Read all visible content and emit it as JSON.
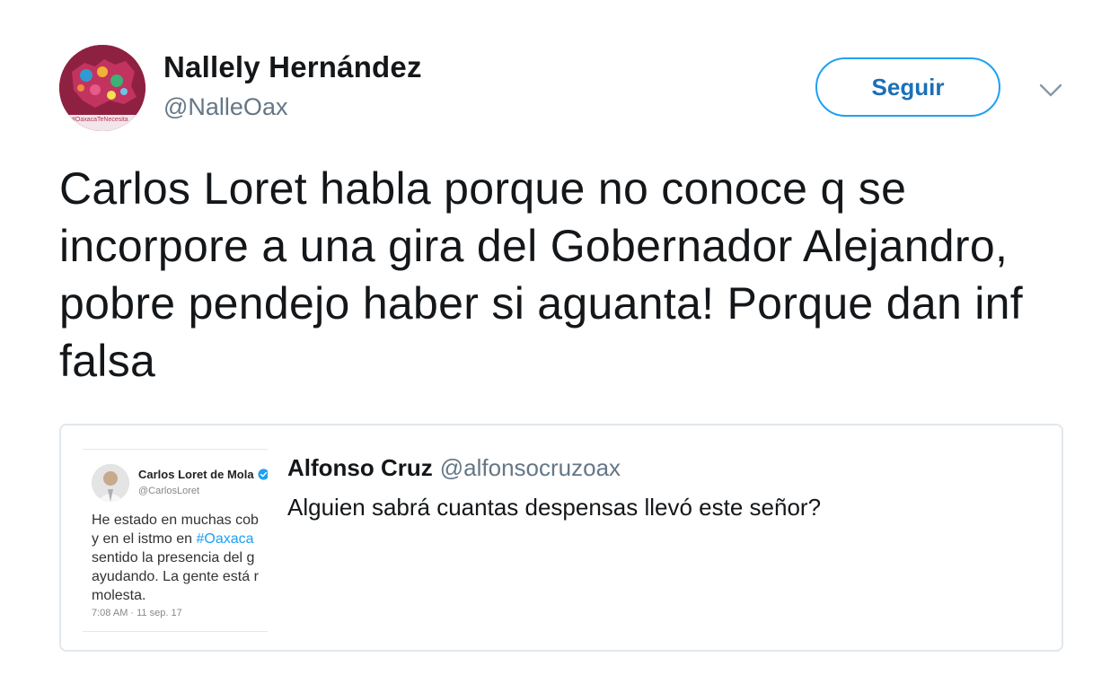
{
  "author": {
    "name": "Nallely Hernández",
    "handle": "@NalleOax",
    "avatar_icon": "profile-avatar-oaxaca-map",
    "avatar_caption": "#OaxacaTeNecesita"
  },
  "follow_button": {
    "label": "Seguir",
    "color": "#1da1f2"
  },
  "menu_icon": "chevron-down-icon",
  "tweet": {
    "text": "Carlos Loret habla porque no conoce q se incorpore a una gira del Gobernador Alejandro, pobre pendejo haber si aguanta! Porque dan inf falsa"
  },
  "quote": {
    "author_name": "Alfonso Cruz",
    "author_handle": "@alfonsocruzoax",
    "text": "Alguien sabrá cuantas despensas llevó este señor?",
    "media": {
      "name": "Carlos Loret de Mola",
      "handle": "@CarlosLoret",
      "verified_icon": "verified-badge-icon",
      "body_lines": [
        "He estado en muchas cob",
        "y en el istmo en ",
        "sentido la presencia del g",
        "ayudando. La gente está r",
        "molesta."
      ],
      "hashtag": "#Oaxaca",
      "timestamp": "7:08 AM · 11 sep. 17"
    }
  },
  "colors": {
    "link": "#1da1f2",
    "text": "#14171a",
    "secondary": "#657786",
    "border": "#e1e8ed"
  }
}
